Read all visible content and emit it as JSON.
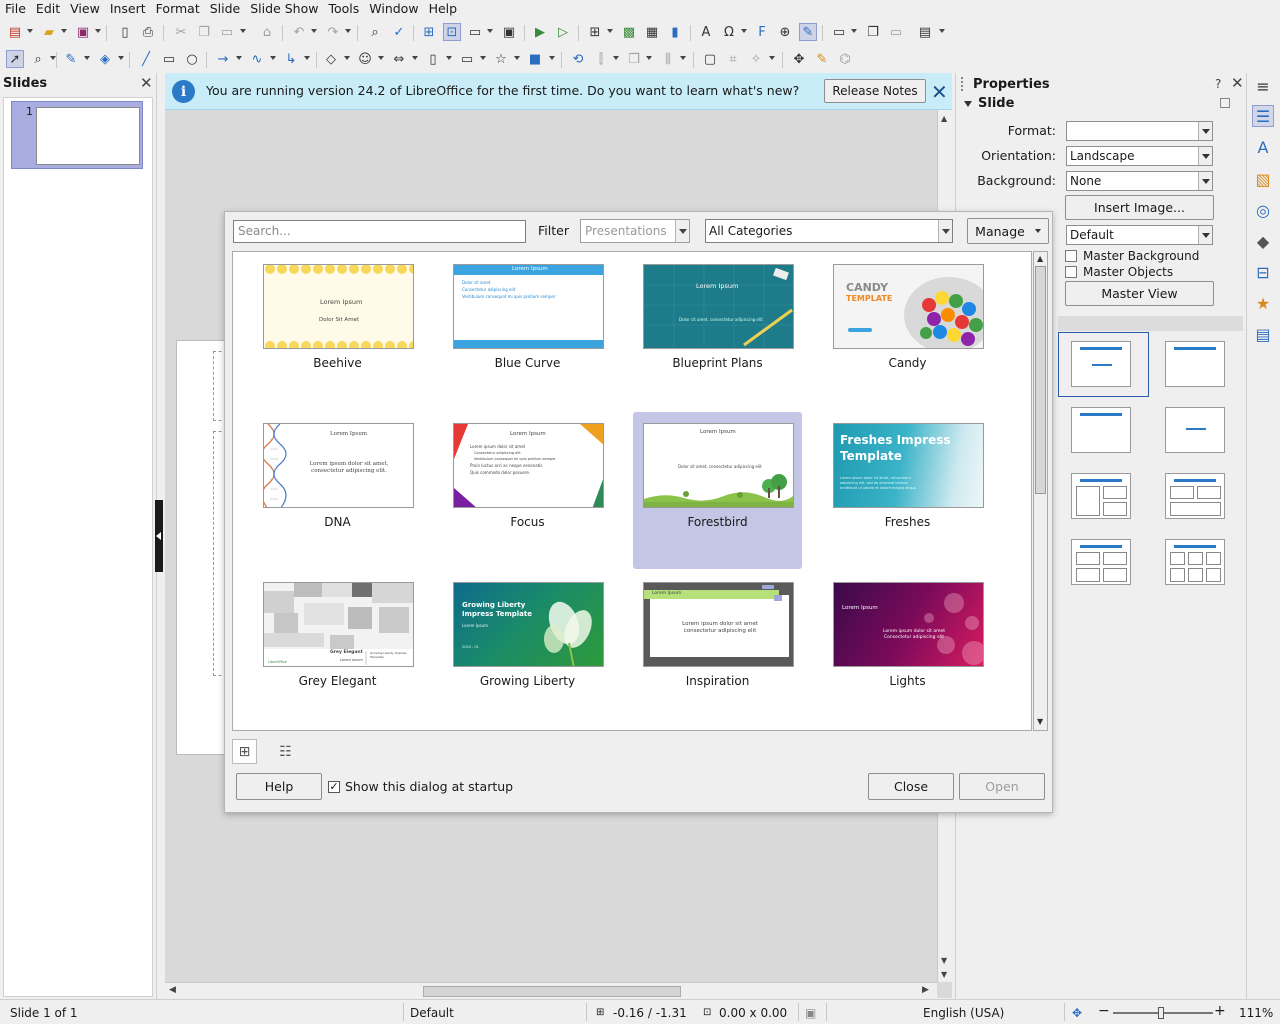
{
  "menubar": {
    "items": [
      "File",
      "Edit",
      "View",
      "Insert",
      "Format",
      "Slide",
      "Slide Show",
      "Tools",
      "Window",
      "Help"
    ]
  },
  "slides_panel": {
    "title": "Slides",
    "slide_number": "1"
  },
  "infobar": {
    "message": "You are running version 24.2 of LibreOffice for the first time. Do you want to learn what's new?",
    "release_notes_label": "Release Notes"
  },
  "properties": {
    "title": "Properties",
    "help_glyph": "?",
    "section": "Slide",
    "format_label": "Format:",
    "format_value": "",
    "orientation_label": "Orientation:",
    "orientation_value": "Landscape",
    "background_label": "Background:",
    "background_value": "None",
    "insert_image_label": "Insert Image...",
    "master_value": "Default",
    "master_background_label": "Master Background",
    "master_objects_label": "Master Objects",
    "master_view_label": "Master View"
  },
  "template_dialog": {
    "search_placeholder": "Search...",
    "filter_label": "Filter",
    "filter_value": "Presentations",
    "category_value": "All Categories",
    "manage_label": "Manage",
    "templates": [
      {
        "name": "Beehive",
        "selected": false
      },
      {
        "name": "Blue Curve",
        "selected": false
      },
      {
        "name": "Blueprint Plans",
        "selected": false
      },
      {
        "name": "Candy",
        "selected": false
      },
      {
        "name": "DNA",
        "selected": false
      },
      {
        "name": "Focus",
        "selected": false
      },
      {
        "name": "Forestbird",
        "selected": true
      },
      {
        "name": "Freshes",
        "selected": false
      },
      {
        "name": "Grey Elegant",
        "selected": false
      },
      {
        "name": "Growing Liberty",
        "selected": false
      },
      {
        "name": "Inspiration",
        "selected": false
      },
      {
        "name": "Lights",
        "selected": false
      }
    ],
    "thumb_text": {
      "beehive_title": "Lorem Ipsum",
      "beehive_sub": "Dolor Sit Amet",
      "bluecurve_title": "Lorem Ipsum",
      "bluecurve_b1": "Dolor sit amet",
      "bluecurve_b2": "Consectetur adipiscing elit",
      "bluecurve_b3": "Vestibulum consequat mi quis pretium semper",
      "blueprint_title": "Lorem Ipsum",
      "blueprint_sub": "Dolor sit amet, consectetur adipiscing elit",
      "candy_title": "CANDY",
      "candy_sub": "TEMPLATE",
      "dna_title": "Lorem Ipsum",
      "dna_body": "Lorem ipsum dolor sit amet, consectetur adipiscing elit.",
      "focus_title": "Lorem Ipsum",
      "focus_b1": "Lorem ipsum dolor sit amet",
      "focus_b2": "Consectetur adipiscing elit",
      "focus_b3": "Vestibulum consequat mi quis pretium semper",
      "focus_b4": "Proin luctus orci ac neque venenatis",
      "focus_b5": "Quis commodo dolor posuere.",
      "forest_title": "Lorem Ipsum",
      "forest_sub": "Dolor sit amet, consectetur adipiscing elit",
      "freshes_title": "Freshes Impress Template",
      "freshes_sub": "Lorem ipsum dolor sit amet, consectetur adipiscing elit, sed do eiusmod tempor incididunt ut labore et dolore magna aliqua",
      "grey_title": "Grey Elegant",
      "grey_sub": "Lorem Ipsum",
      "grey_right": "Growing Liberty Impress Template",
      "grey_logo": "LibreOffice",
      "growing_title": "Growing Liberty Impress Template",
      "growing_sub": "Lorem Ipsum",
      "growing_date": "2024 - 01",
      "inspiration_title": "Lorem Ipsum",
      "inspiration_body": "Lorem ipsum dolor sit amet consectetur adipiscing elit",
      "lights_title": "Lorem Ipsum",
      "lights_body": "Lorem ipsum dolor sit amet Consectetur adipiscing elit"
    },
    "help_label": "Help",
    "startup_label": "Show this dialog at startup",
    "startup_checked": true,
    "close_label": "Close",
    "open_label": "Open"
  },
  "statusbar": {
    "slide_info": "Slide 1 of 1",
    "master": "Default",
    "position": "-0.16 / -1.31",
    "size": "0.00 x 0.00",
    "language": "English (USA)",
    "zoom": "111%"
  },
  "icons": {
    "toolbar1": [
      "new-icon",
      "open-icon",
      "save-icon",
      "export-pdf-icon",
      "print-icon",
      "cut-icon",
      "copy-icon",
      "paste-icon",
      "clone-icon",
      "undo-icon",
      "redo-icon",
      "find-icon",
      "spelling-icon",
      "grid-icon",
      "helplines-icon",
      "display-views-icon",
      "master-slide-icon",
      "start-slideshow-icon",
      "slideshow-current-icon",
      "table-icon",
      "image-icon",
      "media-icon",
      "chart-icon",
      "textbox-icon",
      "special-char-icon",
      "fontwork-icon",
      "hyperlink-icon",
      "show-draw-functions-icon",
      "new-slide-icon",
      "duplicate-slide-icon",
      "delete-slide-icon",
      "slide-layout-icon"
    ],
    "toolbar2": [
      "select-icon",
      "zoom-icon",
      "line-color-icon",
      "fill-color-icon",
      "line-icon",
      "rectangle-icon",
      "ellipse-icon",
      "arrow-icon",
      "curve-icon",
      "connector-icon",
      "basic-shapes-icon",
      "symbol-shapes-icon",
      "block-arrows-icon",
      "flowchart-icon",
      "callouts-icon",
      "stars-icon",
      "3d-objects-icon",
      "rotate-icon",
      "align-icon",
      "arrange-icon",
      "distribute-icon",
      "shadow-icon",
      "crop-icon",
      "filter-icon",
      "points-icon",
      "glue-points-icon",
      "toggle-extrusion-icon"
    ]
  },
  "colors": {
    "infobar_bg": "#c8ecf8",
    "selection": "#c3c6e4",
    "accent": "#2a7ac8"
  }
}
